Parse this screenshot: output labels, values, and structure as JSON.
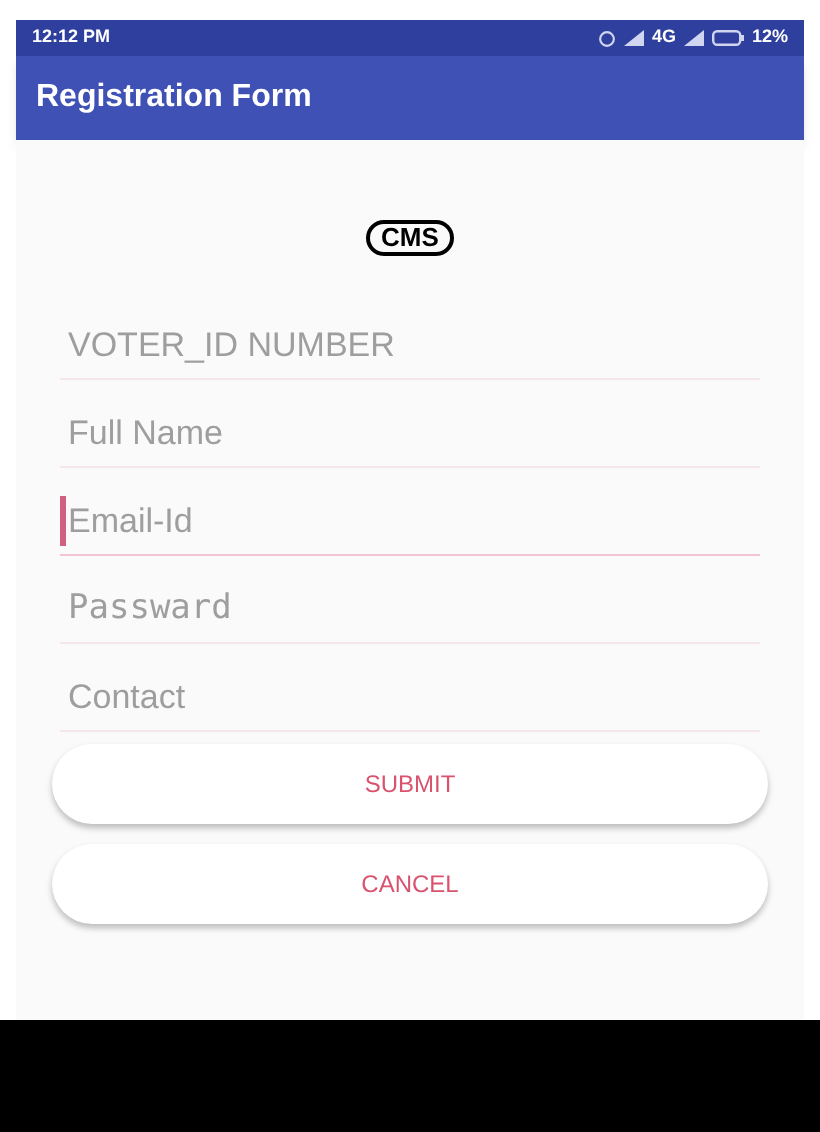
{
  "status_bar": {
    "time": "12:12 PM",
    "network": "4G",
    "battery": "12%"
  },
  "app_bar": {
    "title": "Registration Form"
  },
  "logo": {
    "text": "CMS"
  },
  "fields": [
    {
      "placeholder": "VOTER_ID NUMBER",
      "kind": "text",
      "focused": false
    },
    {
      "placeholder": "Full Name",
      "kind": "text",
      "focused": false
    },
    {
      "placeholder": "Email-Id",
      "kind": "text",
      "focused": true
    },
    {
      "placeholder": "Passward",
      "kind": "password",
      "focused": false
    },
    {
      "placeholder": "Contact",
      "kind": "text",
      "focused": false
    }
  ],
  "buttons": [
    {
      "label": "SUBMIT"
    },
    {
      "label": "CANCEL"
    }
  ]
}
